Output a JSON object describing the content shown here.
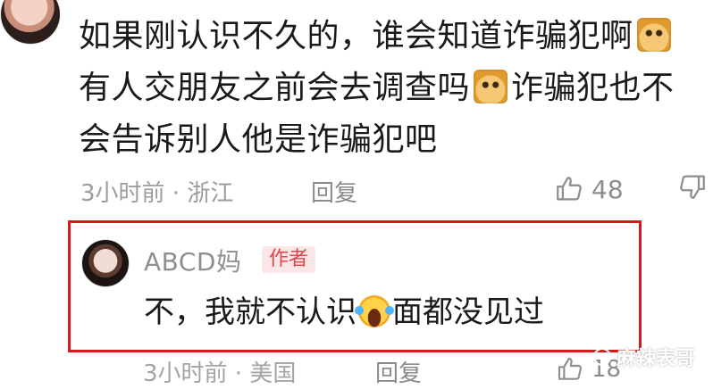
{
  "comment": {
    "line1": "如果刚认识不久的，谁会知道诈骗犯啊",
    "line2a": "有人交朋友之前会去调查吗",
    "line2b": "诈骗犯也不",
    "line3": "会告诉别人他是诈骗犯吧",
    "time": "3小时前 · 浙江",
    "reply_label": "回复",
    "likes": "48",
    "icons": {
      "cat_emoji": "cat-emoji",
      "thumb_up": "thumb-up-icon",
      "thumb_down": "thumb-down-icon"
    }
  },
  "reply": {
    "name": "ABCD妈",
    "badge": "作者",
    "text_before": "不，我就不认识",
    "text_after": "面都没见过",
    "time": "3小时前 · 美国",
    "reply_label": "回复",
    "likes": "18",
    "highlight_color": "#d41a1a"
  },
  "watermark": {
    "text": "麻辣表哥"
  }
}
